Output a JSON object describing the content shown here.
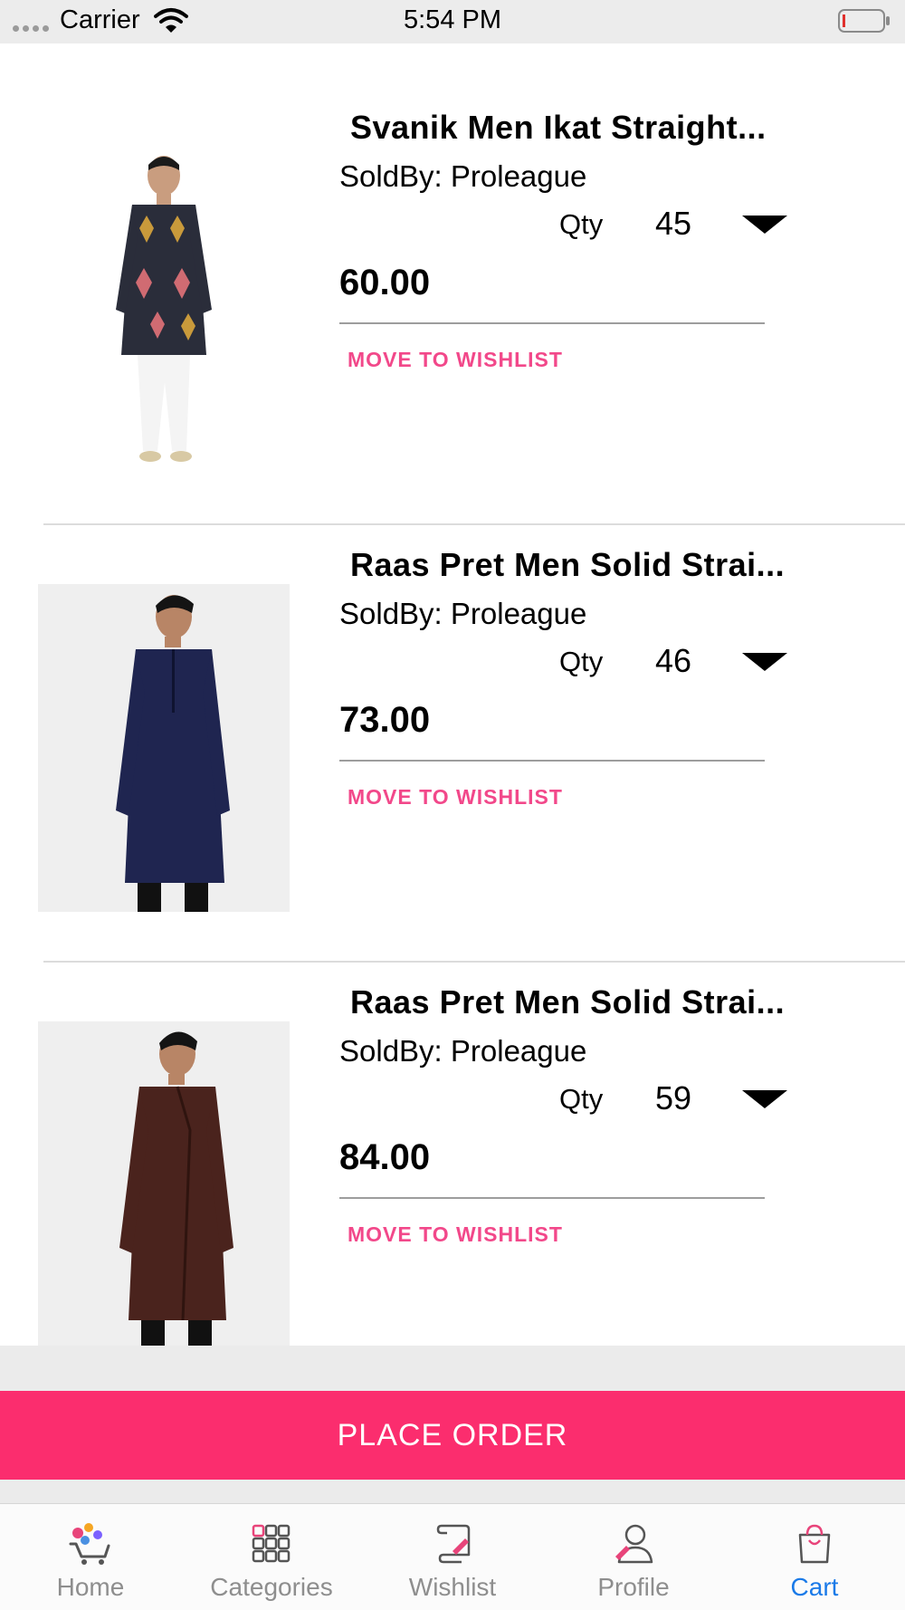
{
  "status_bar": {
    "carrier": "Carrier",
    "time": "5:54 PM"
  },
  "cart": {
    "items": [
      {
        "title": "Svanik Men Ikat Straight...",
        "sold_by": "SoldBy: Proleague",
        "qty_label": "Qty",
        "qty": "45",
        "price": "60.00",
        "wishlist_label": "MOVE TO WISHLIST"
      },
      {
        "title": "Raas Pret Men Solid Strai...",
        "sold_by": "SoldBy: Proleague",
        "qty_label": "Qty",
        "qty": "46",
        "price": "73.00",
        "wishlist_label": "MOVE TO WISHLIST"
      },
      {
        "title": "Raas Pret Men Solid Strai...",
        "sold_by": "SoldBy: Proleague",
        "qty_label": "Qty",
        "qty": "59",
        "price": "84.00",
        "wishlist_label": "MOVE TO WISHLIST"
      }
    ]
  },
  "place_order_label": "PLACE ORDER",
  "tab_bar": {
    "tabs": [
      {
        "label": "Home",
        "icon": "home-cart-icon"
      },
      {
        "label": "Categories",
        "icon": "grid-icon"
      },
      {
        "label": "Wishlist",
        "icon": "scroll-icon"
      },
      {
        "label": "Profile",
        "icon": "user-icon"
      },
      {
        "label": "Cart",
        "icon": "shopping-bag-icon"
      }
    ],
    "active": "Cart"
  },
  "colors": {
    "accent": "#fb2d6e",
    "wishlist_text": "#f2488a",
    "active_tab": "#1a7ae8",
    "inactive_tab": "#8e8e8e"
  }
}
